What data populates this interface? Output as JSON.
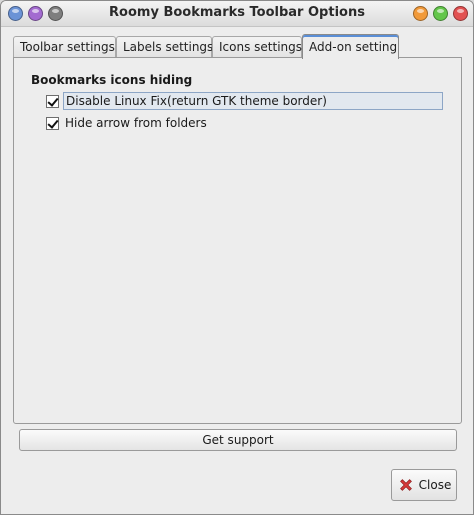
{
  "window": {
    "title": "Roomy Bookmarks Toolbar Options",
    "left_buttons": [
      "blue",
      "purple",
      "gray"
    ],
    "right_buttons": [
      "orange",
      "green",
      "red"
    ],
    "colors": {
      "blue": "#6b93d6",
      "purple": "#a36bd0",
      "gray": "#7e7e7e",
      "orange": "#f19a3a",
      "green": "#63c64a",
      "red": "#e25151"
    }
  },
  "tabs": [
    {
      "label": "Toolbar settings",
      "active": false
    },
    {
      "label": "Labels settings",
      "active": false
    },
    {
      "label": "Icons settings",
      "active": false
    },
    {
      "label": "Add-on setting",
      "active": true
    }
  ],
  "panel": {
    "group_title": "Bookmarks icons hiding",
    "options": [
      {
        "label": "Disable Linux Fix(return GTK theme border)",
        "checked": true,
        "focused": true
      },
      {
        "label": "Hide arrow from folders",
        "checked": true,
        "focused": false
      }
    ]
  },
  "buttons": {
    "support_label": "Get support",
    "close_label": "Close",
    "close_icon": "red-x-icon"
  }
}
